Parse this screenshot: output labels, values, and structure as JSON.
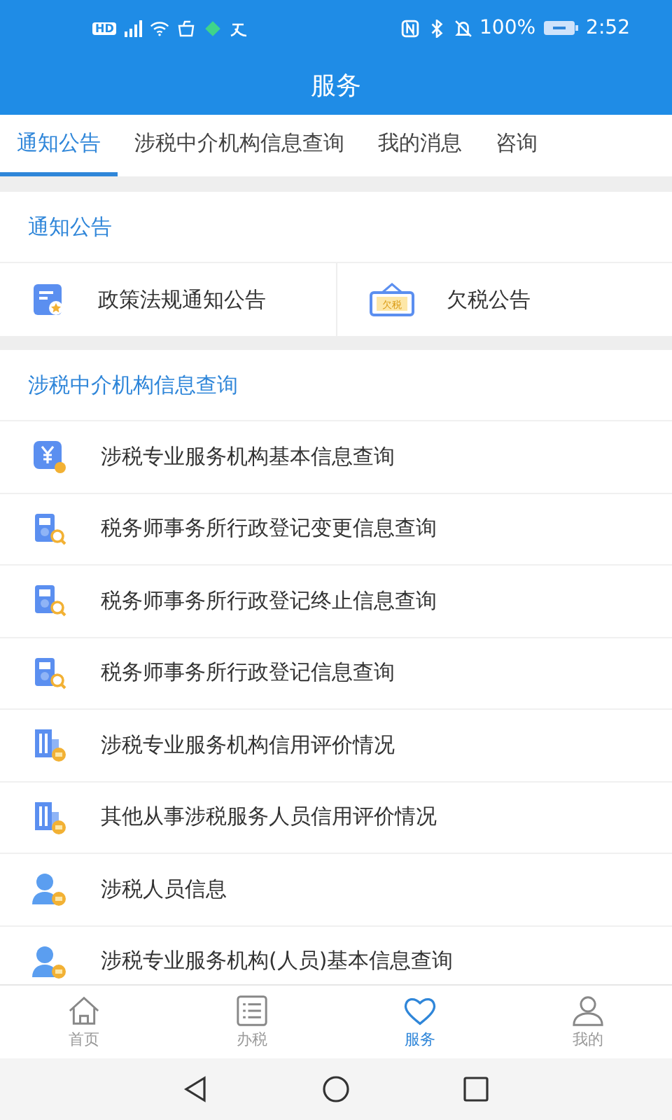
{
  "status_bar": {
    "time": "2:52",
    "battery": "100%",
    "hd": "HD"
  },
  "header": {
    "title": "服务"
  },
  "tabs": [
    {
      "label": "通知公告",
      "selected": true
    },
    {
      "label": "涉税中介机构信息查询",
      "selected": false
    },
    {
      "label": "我的消息",
      "selected": false
    },
    {
      "label": "咨询",
      "selected": false
    }
  ],
  "notices": {
    "title": "通知公告",
    "items": [
      {
        "label": "政策法规通知公告",
        "kind": "document"
      },
      {
        "label": "欠税公告",
        "kind": "sign",
        "icon_text": "欠税"
      }
    ]
  },
  "agencies": {
    "title": "涉税中介机构信息查询",
    "items": [
      {
        "label": "涉税专业服务机构基本信息查询",
        "kind": "currency"
      },
      {
        "label": "税务师事务所行政登记变更信息查询",
        "kind": "search"
      },
      {
        "label": "税务师事务所行政登记终止信息查询",
        "kind": "search"
      },
      {
        "label": "税务师事务所行政登记信息查询",
        "kind": "search"
      },
      {
        "label": "涉税专业服务机构信用评价情况",
        "kind": "agency"
      },
      {
        "label": "其他从事涉税服务人员信用评价情况",
        "kind": "agency"
      },
      {
        "label": "涉税人员信息",
        "kind": "person"
      },
      {
        "label": "涉税专业服务机构(人员)基本信息查询",
        "kind": "person"
      }
    ]
  },
  "bottom_nav": [
    {
      "label": "首页",
      "kind": "home",
      "selected": false
    },
    {
      "label": "办税",
      "kind": "list",
      "selected": false
    },
    {
      "label": "服务",
      "kind": "heart",
      "selected": true
    },
    {
      "label": "我的",
      "kind": "user",
      "selected": false
    }
  ]
}
